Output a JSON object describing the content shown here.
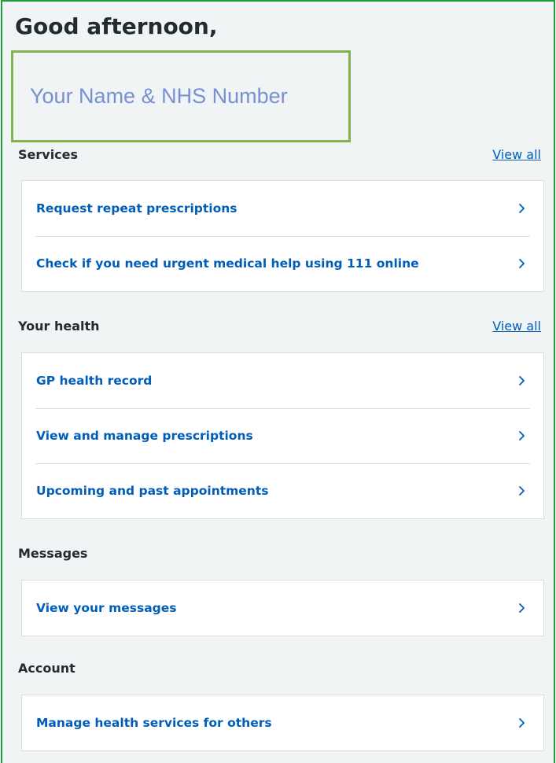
{
  "greeting": "Good afternoon,",
  "name_placeholder": "Your Name & NHS Number",
  "sections": {
    "services": {
      "title": "Services",
      "view_all": "View all",
      "items": [
        {
          "label": "Request repeat prescriptions"
        },
        {
          "label": "Check if you need urgent medical help using 111 online"
        }
      ]
    },
    "your_health": {
      "title": "Your health",
      "view_all": "View all",
      "items": [
        {
          "label": "GP health record"
        },
        {
          "label": "View and manage prescriptions"
        },
        {
          "label": "Upcoming and past appointments"
        }
      ]
    },
    "messages": {
      "title": "Messages",
      "items": [
        {
          "label": "View your messages"
        }
      ]
    },
    "account": {
      "title": "Account",
      "items": [
        {
          "label": "Manage health services for others"
        }
      ]
    }
  },
  "icons": {
    "row_arrow": "chevron-right-icon"
  },
  "colors": {
    "page_background": "#f0f4f5",
    "link_blue": "#005eb8",
    "text_dark": "#212b32",
    "frame_green": "#1f9d3a",
    "name_box_border": "#82b350",
    "name_text": "#7890d2"
  }
}
